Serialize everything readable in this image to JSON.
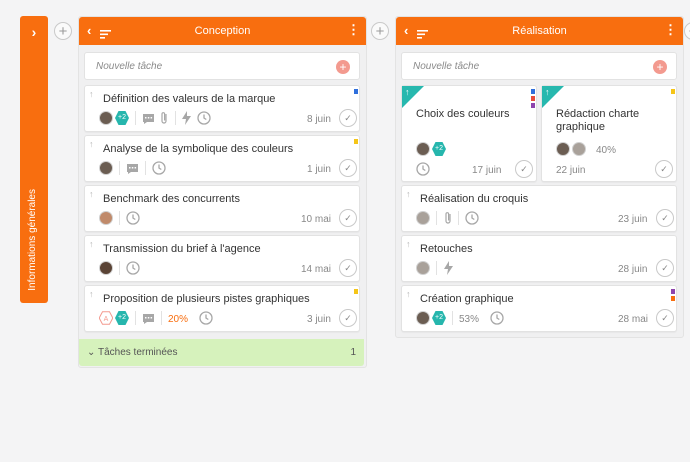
{
  "collapsed_column": {
    "label": "Informations générales",
    "chevron": "›"
  },
  "add_column_symbol": "+",
  "columns": [
    {
      "title": "Conception",
      "new_task_placeholder": "Nouvelle tâche",
      "done_section": {
        "label": "Tâches terminées",
        "count": "1"
      },
      "cards": [
        {
          "title": "Définition des valeurs de la marque",
          "date": "8 juin",
          "extra_members": "+2"
        },
        {
          "title": "Analyse de la symbolique des couleurs",
          "date": "1 juin"
        },
        {
          "title": "Benchmark des concurrents",
          "date": "10 mai"
        },
        {
          "title": "Transmission du brief à l'agence",
          "date": "14 mai"
        },
        {
          "title": "Proposition de plusieurs pistes graphiques",
          "date": "3 juin",
          "extra_members": "+2",
          "progress": "20%",
          "initial": "A"
        }
      ]
    },
    {
      "title": "Réalisation",
      "new_task_placeholder": "Nouvelle tâche",
      "cards": [
        {
          "title": "Choix des couleurs",
          "date": "17 juin",
          "extra_members": "+2"
        },
        {
          "title": "Rédaction charte graphique",
          "date": "22 juin",
          "progress": "40%"
        },
        {
          "title": "Réalisation du croquis",
          "date": "23 juin"
        },
        {
          "title": "Retouches",
          "date": "28 juin"
        },
        {
          "title": "Création graphique",
          "date": "28 mai",
          "extra_members": "+2",
          "progress": "53%"
        }
      ]
    }
  ],
  "colors": {
    "header_orange": "#f86e0f",
    "teal": "#26b6ad",
    "done_green": "#d6f2bc",
    "tag_blue": "#2f6fdc",
    "tag_yellow": "#f5c518",
    "tag_purple": "#8e44ad",
    "tag_red": "#e74c3c"
  }
}
